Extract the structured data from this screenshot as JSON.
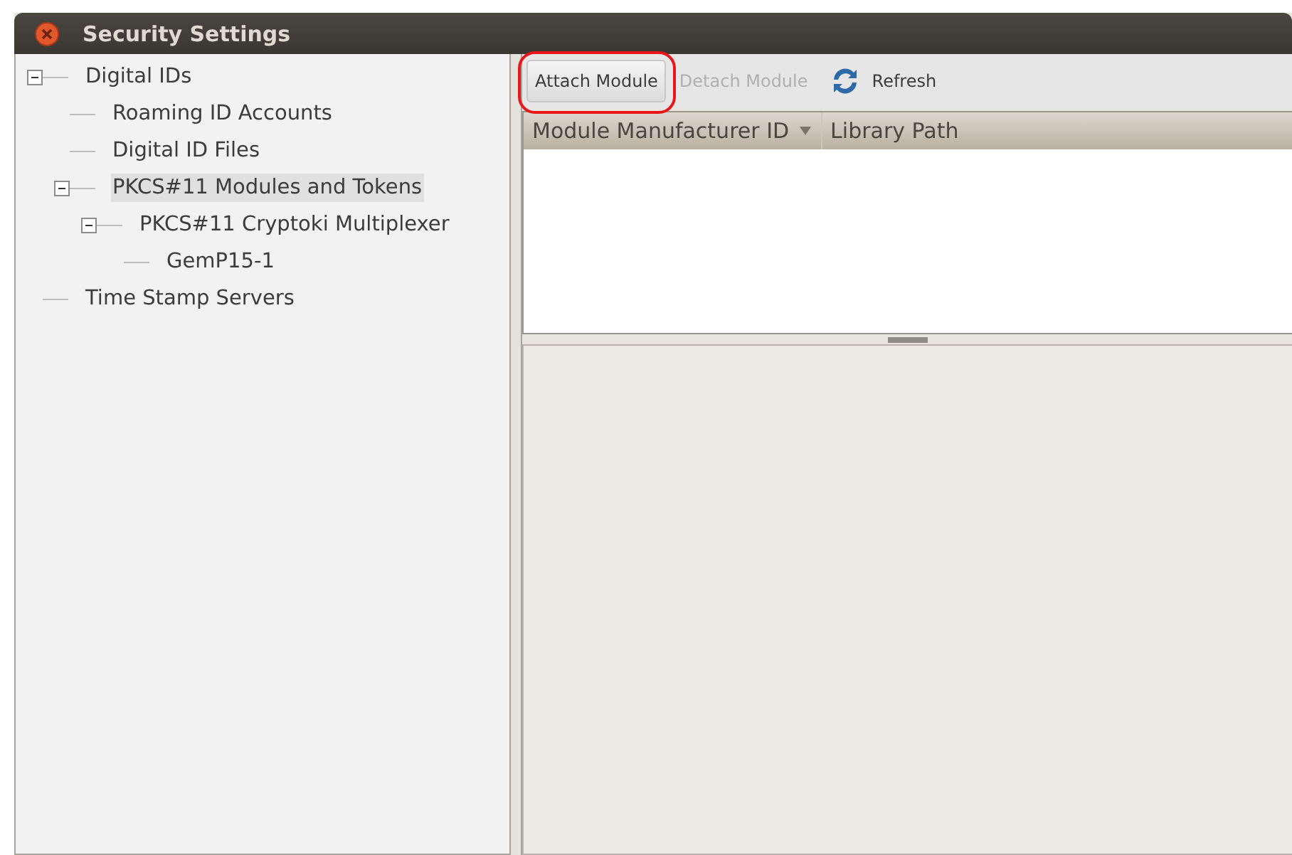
{
  "window": {
    "title": "Security Settings"
  },
  "sidebar": {
    "items": [
      {
        "label": "Digital IDs",
        "selected": false,
        "expanded": true,
        "children": [
          {
            "label": "Roaming ID Accounts",
            "selected": false
          },
          {
            "label": "Digital ID Files",
            "selected": false
          },
          {
            "label": "PKCS#11 Modules and Tokens",
            "selected": true,
            "expanded": true,
            "children": [
              {
                "label": "PKCS#11 Cryptoki Multiplexer",
                "selected": false,
                "expanded": true,
                "children": [
                  {
                    "label": "GemP15-1",
                    "selected": false
                  }
                ]
              }
            ]
          }
        ]
      },
      {
        "label": "Time Stamp Servers",
        "selected": false
      }
    ]
  },
  "toolbar": {
    "buttons": [
      {
        "kind": "text",
        "label": "Attach Module",
        "disabled": false,
        "annotated": true
      },
      {
        "kind": "text",
        "label": "Detach Module",
        "disabled": true,
        "annotated": false
      },
      {
        "kind": "refresh",
        "label": "Refresh",
        "disabled": false,
        "annotated": false
      }
    ]
  },
  "table": {
    "columns": [
      {
        "label": "Module Manufacturer ID",
        "sorted": true
      },
      {
        "label": "Library Path",
        "sorted": false
      }
    ]
  }
}
